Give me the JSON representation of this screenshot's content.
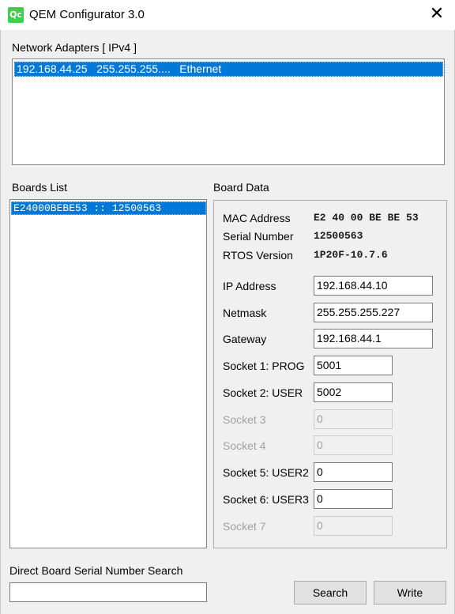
{
  "window": {
    "title": "QEM Configurator 3.0",
    "icon": "qt-creator-icon",
    "close_glyph": "✕"
  },
  "adapters": {
    "label": "Network Adapters [ IPv4 ]",
    "selected": "192.168.44.25   255.255.255....   Ethernet"
  },
  "boards": {
    "label": "Boards List",
    "selected": "E24000BEBE53 :: 12500563"
  },
  "board_data": {
    "label": "Board Data",
    "mac_label": "MAC Address",
    "mac_value": "E2 40 00 BE BE 53",
    "serial_label": "Serial Number",
    "serial_value": "12500563",
    "rtos_label": "RTOS Version",
    "rtos_value": "1P20F-10.7.6",
    "ip_label": "IP Address",
    "ip_value": "192.168.44.10",
    "netmask_label": "Netmask",
    "netmask_value": "255.255.255.227",
    "gateway_label": "Gateway",
    "gateway_value": "192.168.44.1",
    "socket1_label": "Socket 1: PROG",
    "socket1_value": "5001",
    "socket2_label": "Socket 2: USER",
    "socket2_value": "5002",
    "socket3_label": "Socket 3",
    "socket3_value": "0",
    "socket4_label": "Socket 4",
    "socket4_value": "0",
    "socket5_label": "Socket 5: USER2",
    "socket5_value": "0",
    "socket6_label": "Socket 6: USER3",
    "socket6_value": "0",
    "socket7_label": "Socket 7",
    "socket7_value": "0"
  },
  "search": {
    "label": "Direct Board Serial Number Search",
    "value": "",
    "search_button": "Search",
    "write_button": "Write"
  },
  "colors": {
    "selection": "#0078d7",
    "window_bg": "#f0f0f0",
    "disabled_text": "#a0a0a0"
  }
}
